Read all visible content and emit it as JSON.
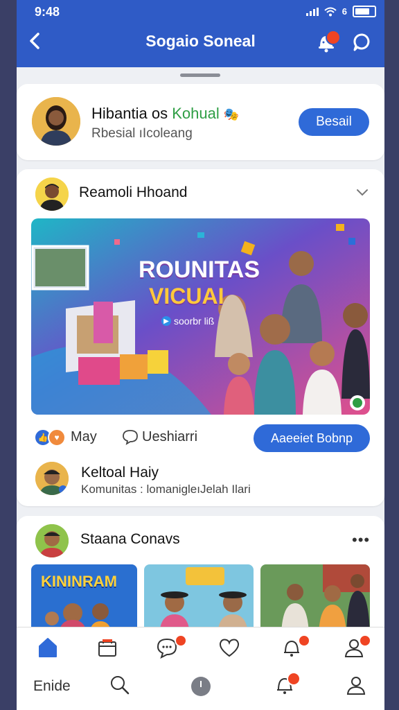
{
  "status_bar": {
    "time": "9:48"
  },
  "header": {
    "title": "Sogaio Soneal"
  },
  "profile_card": {
    "name_prefix": "Hibantia os",
    "name_highlight": "Kohual",
    "subtitle": "Rbesial ıIcoleang",
    "button_label": "Besail"
  },
  "post": {
    "author": "Reamoli Hhoand",
    "banner": {
      "title_line1": "ROUNITAS",
      "title_line2": "VICUAI",
      "tag": "soorbr liß"
    },
    "reactions_count": "May",
    "comment_label": "Ueshiarri",
    "action_button": "Aaeeiet Bobnp",
    "comment": {
      "author": "Keltoal Haiy",
      "text": "Komunitas : lomanigleıJelah Ilari"
    }
  },
  "post2": {
    "author": "Staana Conavs",
    "thumb_title": "KININRAM"
  },
  "bottom_nav": {
    "home_label": "Enide"
  },
  "colors": {
    "brand": "#2f5bc6",
    "button": "#2f6ad8",
    "badge": "#ef4423",
    "highlight_green": "#2e9e44"
  },
  "icons": [
    "back-arrow-icon",
    "notification-bell-icon",
    "chat-icon",
    "chevron-down-icon",
    "like-icon",
    "love-icon",
    "comment-icon",
    "more-icon",
    "home-icon",
    "calendar-icon",
    "messages-icon",
    "heart-icon",
    "bell-icon",
    "profile-icon",
    "search-icon",
    "clock-icon"
  ]
}
